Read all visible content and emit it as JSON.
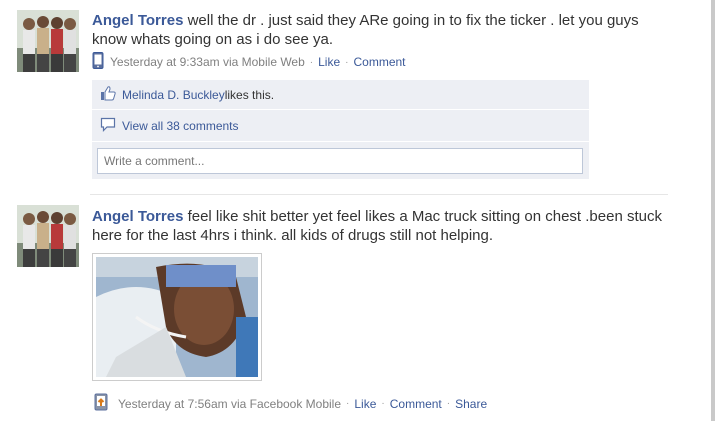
{
  "stories": [
    {
      "actor": "Angel Torres",
      "message": " well the dr . just said they ARe going in to fix the ticker . let you guys know whats going on as i do see ya.",
      "via_icon": "mobile-phone-icon",
      "timestamp": "Yesterday at 9:33am via Mobile Web",
      "like_label": "Like",
      "comment_label": "Comment",
      "likes": {
        "name": "Melinda D. Buckley",
        "suffix": " likes this."
      },
      "view_all_comments": "View all 38 comments",
      "comment_placeholder": "Write a comment..."
    },
    {
      "actor": "Angel Torres",
      "message": " feel like shit better yet feel likes a Mac truck sitting on chest .been stuck here for the last 4hrs i think. all kids of drugs still not helping.",
      "via_icon": "mobile-upload-icon",
      "timestamp": "Yesterday at 7:56am via Facebook Mobile",
      "like_label": "Like",
      "comment_label": "Comment",
      "share_label": "Share"
    }
  ],
  "colors": {
    "link": "#3b5998",
    "meta_text": "#808080",
    "ufi_background": "#edeff4",
    "input_border": "#bdc7d8"
  }
}
